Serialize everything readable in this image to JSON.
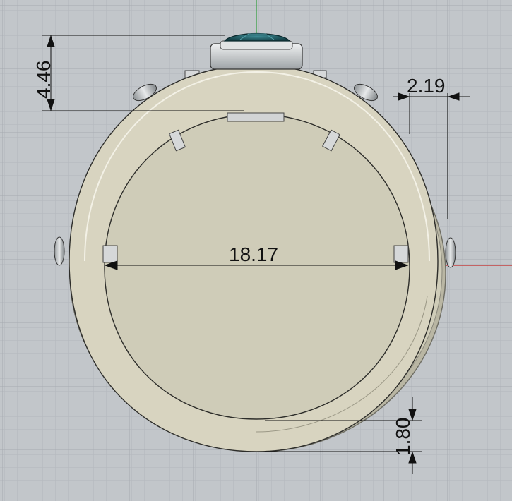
{
  "viewport": {
    "background": "#c2c6ca",
    "grid_minor_color": "#b3b7bc",
    "grid_major_color": "#a3a8ae",
    "axis_x_color": "#c62828",
    "axis_y_color": "#2e9d3a"
  },
  "model": {
    "object": "ring",
    "band_color": "#d8d4c0",
    "band_shadow_color": "#b9b6a3",
    "gem_color": "#1f5f66",
    "metal_color": "#c9cccd"
  },
  "dimensions": {
    "top_height": "4.46",
    "shoulder_width": "2.19",
    "inner_diameter": "18.17",
    "band_thickness": "1.80"
  }
}
